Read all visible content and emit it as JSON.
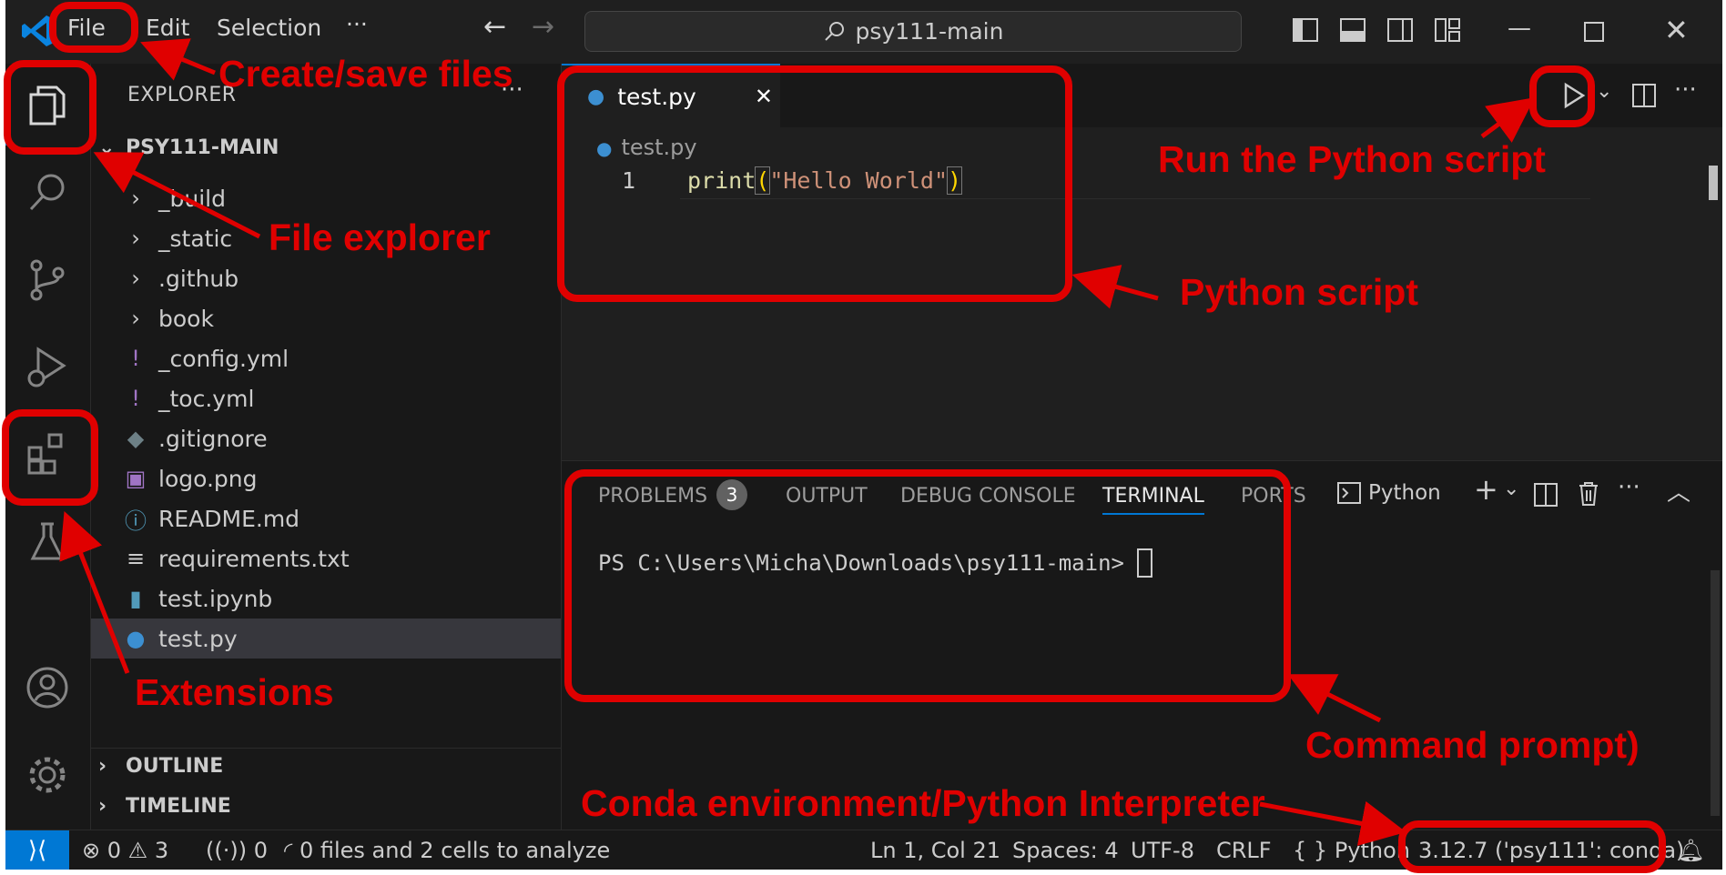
{
  "menu": {
    "file": "File",
    "edit": "Edit",
    "selection": "Selection",
    "more": "···"
  },
  "search": {
    "text": "psy111-main"
  },
  "explorer": {
    "title": "EXPLORER",
    "root": "PSY111-MAIN",
    "items": [
      {
        "label": "_build",
        "icon": "chevron-right-icon",
        "glyph": "›"
      },
      {
        "label": "_static",
        "icon": "chevron-right-icon",
        "glyph": "›"
      },
      {
        "label": ".github",
        "icon": "chevron-right-icon",
        "glyph": "›"
      },
      {
        "label": "book",
        "icon": "chevron-right-icon",
        "glyph": "›"
      },
      {
        "label": "_config.yml",
        "icon": "yaml-file-icon",
        "glyph": "!"
      },
      {
        "label": "_toc.yml",
        "icon": "yaml-file-icon",
        "glyph": "!"
      },
      {
        "label": ".gitignore",
        "icon": "git-file-icon",
        "glyph": "◆"
      },
      {
        "label": "logo.png",
        "icon": "image-file-icon",
        "glyph": "▣"
      },
      {
        "label": "README.md",
        "icon": "info-file-icon",
        "glyph": "ⓘ"
      },
      {
        "label": "requirements.txt",
        "icon": "text-file-icon",
        "glyph": "≡"
      },
      {
        "label": "test.ipynb",
        "icon": "notebook-file-icon",
        "glyph": "▮"
      },
      {
        "label": "test.py",
        "icon": "python-file-icon",
        "glyph": "●"
      }
    ],
    "outline": "OUTLINE",
    "timeline": "TIMELINE"
  },
  "editor": {
    "tab_label": "test.py",
    "breadcrumb": "test.py",
    "line_number": "1",
    "code_fn": "print",
    "code_open": "(",
    "code_str": "\"Hello World\"",
    "code_close": ")"
  },
  "panel": {
    "tabs": {
      "problems": "PROBLEMS",
      "problems_count": "3",
      "output": "OUTPUT",
      "debug": "DEBUG CONSOLE",
      "terminal": "TERMINAL",
      "ports": "PORTS"
    },
    "shell": "Python",
    "prompt": "PS C:\\Users\\Micha\\Downloads\\psy111-main>"
  },
  "status": {
    "errors": "0",
    "warnings": "3",
    "ports": "0",
    "analysis": "0 files and 2 cells to analyze",
    "position": "Ln 1, Col 21",
    "spaces": "Spaces: 4",
    "encoding": "UTF-8",
    "eol": "CRLF",
    "language": "Python",
    "interpreter": "3.12.7 ('psy111': conda)"
  },
  "annotations": {
    "create_save": "Create/save files",
    "file_explorer": "File explorer",
    "extensions": "Extensions",
    "run_script": "Run the Python script",
    "python_script": "Python script",
    "command_prompt": "Command prompt)",
    "conda_env": "Conda environment/Python Interpreter"
  },
  "colors": {
    "accent": "#0078d4",
    "annotation": "#e00000",
    "string": "#ce9178",
    "function": "#dcdcaa",
    "bracket": "#ffd700"
  }
}
